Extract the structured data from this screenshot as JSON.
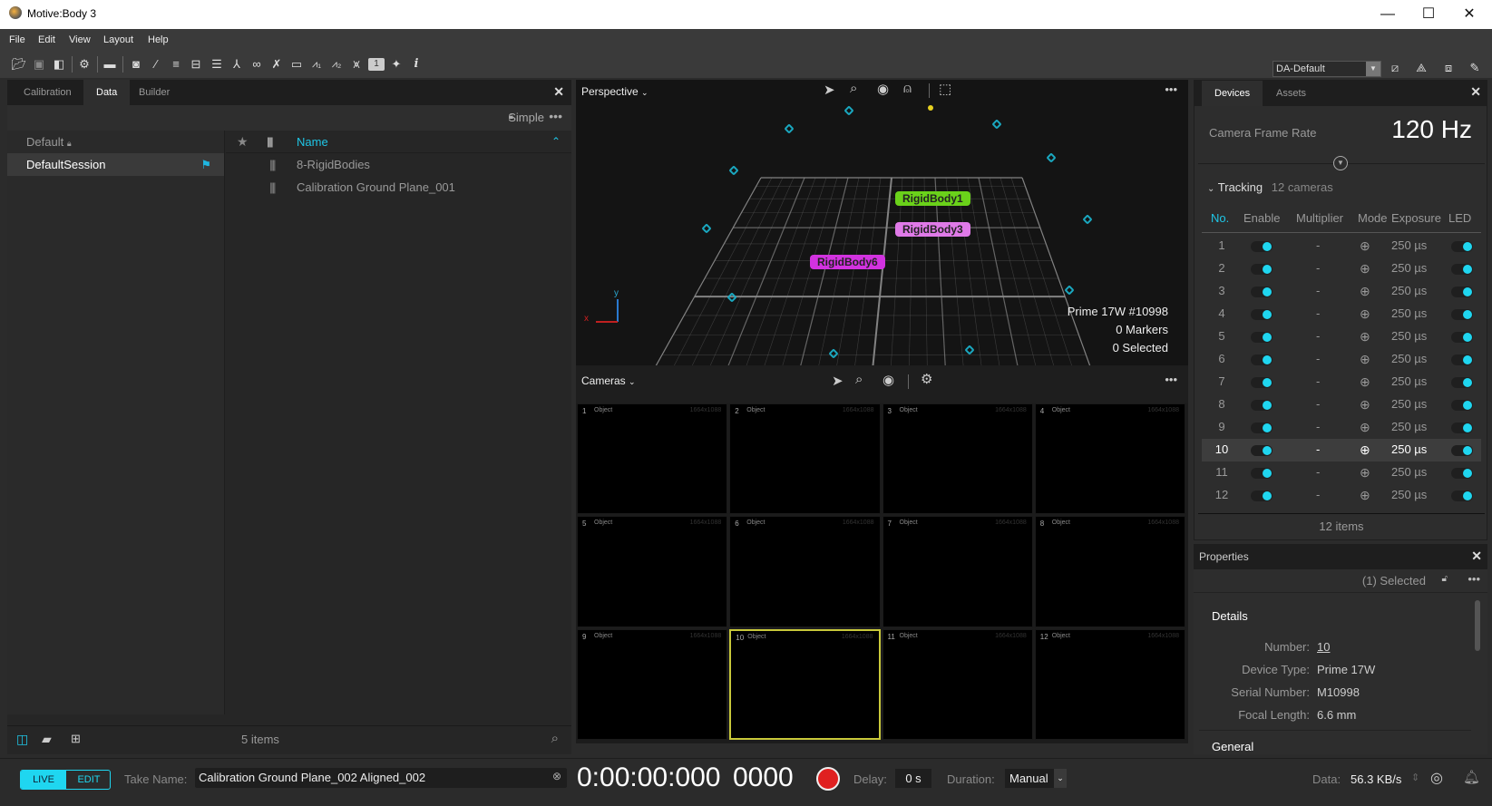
{
  "window": {
    "title": "Motive:Body 3",
    "minimize": "—",
    "maximize": "☐",
    "close": "✕"
  },
  "menu": [
    "File",
    "Edit",
    "View",
    "Layout",
    "Help"
  ],
  "toolbar": {
    "icons": [
      "open-icon",
      "save-icon",
      "save-as-icon",
      "settings-icon",
      "panel-icon",
      "camera-snapshot-icon",
      "wand-icon",
      "database-icon",
      "archive-icon",
      "list-settings-icon",
      "skeleton-icon",
      "link-icon",
      "tools-icon",
      "tag-icon",
      "graph1-icon",
      "graph2-icon",
      "filter-icon",
      "number-one-icon",
      "marker-icon",
      "info-icon"
    ],
    "layout_select": "DA-Default",
    "layout_icons": [
      "layout-calibrate-icon",
      "layout-create-icon",
      "layout-capture-icon",
      "layout-edit-icon"
    ]
  },
  "left_panel": {
    "tabs": [
      "Calibration",
      "Data",
      "Builder"
    ],
    "active_tab": "Data",
    "mode_label": "Simple",
    "sessions_header": "Default",
    "sessions": [
      {
        "name": "DefaultSession",
        "selected": true
      }
    ],
    "takes_header": {
      "name_col": "Name"
    },
    "takes": [
      {
        "name": "8-RigidBodies"
      },
      {
        "name": "Calibration Ground Plane_001"
      }
    ],
    "footer_count": "5 items"
  },
  "perspective": {
    "title": "Perspective",
    "rigid_bodies": [
      {
        "label": "RigidBody1",
        "color": "#6ad21a"
      },
      {
        "label": "RigidBody3",
        "color": "#e07ae8"
      },
      {
        "label": "RigidBody6",
        "color": "#d232e0"
      }
    ],
    "info": {
      "camera": "Prime 17W #10998",
      "markers": "0 Markers",
      "selected": "0 Selected"
    },
    "axis": {
      "x": "x",
      "y": "y"
    }
  },
  "cameras": {
    "title": "Cameras",
    "tiles": [
      {
        "num": "1",
        "mode": "Object",
        "res": "1664x1088"
      },
      {
        "num": "2",
        "mode": "Object",
        "res": "1664x1088"
      },
      {
        "num": "3",
        "mode": "Object",
        "res": "1664x1088"
      },
      {
        "num": "4",
        "mode": "Object",
        "res": "1664x1088"
      },
      {
        "num": "5",
        "mode": "Object",
        "res": "1664x1088"
      },
      {
        "num": "6",
        "mode": "Object",
        "res": "1664x1088"
      },
      {
        "num": "7",
        "mode": "Object",
        "res": "1664x1088"
      },
      {
        "num": "8",
        "mode": "Object",
        "res": "1664x1088"
      },
      {
        "num": "9",
        "mode": "Object",
        "res": "1664x1088"
      },
      {
        "num": "10",
        "mode": "Object",
        "res": "1664x1088",
        "selected": true
      },
      {
        "num": "11",
        "mode": "Object",
        "res": "1664x1088"
      },
      {
        "num": "12",
        "mode": "Object",
        "res": "1664x1088"
      }
    ]
  },
  "devices": {
    "tabs": [
      "Devices",
      "Assets"
    ],
    "frame_rate_label": "Camera Frame Rate",
    "frame_rate": "120 Hz",
    "group": "Tracking",
    "group_count": "12 cameras",
    "columns": [
      "No.",
      "Enable",
      "Multiplier",
      "Mode",
      "Exposure",
      "LED"
    ],
    "rows": [
      {
        "no": "1",
        "mult": "-",
        "exp": "250 µs",
        "enable": true,
        "led": true
      },
      {
        "no": "2",
        "mult": "-",
        "exp": "250 µs",
        "enable": true,
        "led": true
      },
      {
        "no": "3",
        "mult": "-",
        "exp": "250 µs",
        "enable": true,
        "led": true
      },
      {
        "no": "4",
        "mult": "-",
        "exp": "250 µs",
        "enable": true,
        "led": true
      },
      {
        "no": "5",
        "mult": "-",
        "exp": "250 µs",
        "enable": true,
        "led": true
      },
      {
        "no": "6",
        "mult": "-",
        "exp": "250 µs",
        "enable": true,
        "led": true
      },
      {
        "no": "7",
        "mult": "-",
        "exp": "250 µs",
        "enable": true,
        "led": true
      },
      {
        "no": "8",
        "mult": "-",
        "exp": "250 µs",
        "enable": true,
        "led": true
      },
      {
        "no": "9",
        "mult": "-",
        "exp": "250 µs",
        "enable": true,
        "led": true
      },
      {
        "no": "10",
        "mult": "-",
        "exp": "250 µs",
        "enable": true,
        "led": true,
        "selected": true
      },
      {
        "no": "11",
        "mult": "-",
        "exp": "250 µs",
        "enable": true,
        "led": true
      },
      {
        "no": "12",
        "mult": "-",
        "exp": "250 µs",
        "enable": true,
        "led": true
      }
    ],
    "footer": "12 items"
  },
  "properties": {
    "title": "Properties",
    "selected": "(1) Selected",
    "section": "Details",
    "fields": [
      {
        "label": "Number:",
        "value": "10"
      },
      {
        "label": "Device Type:",
        "value": "Prime 17W"
      },
      {
        "label": "Serial Number:",
        "value": "M10998"
      },
      {
        "label": "Focal Length:",
        "value": "6.6 mm"
      }
    ],
    "next_section": "General"
  },
  "bottom": {
    "live": "LIVE",
    "edit": "EDIT",
    "take_name_label": "Take Name:",
    "take_name": "Calibration Ground Plane_002 Aligned_002",
    "timecode": "0:00:00:000",
    "frame": "0000",
    "delay_label": "Delay:",
    "delay": "0 s",
    "duration_label": "Duration:",
    "duration": "Manual",
    "data_label": "Data:",
    "data_rate": "56.3 KB/s"
  },
  "colors": {
    "accent": "#1fd6f0",
    "record": "#e02020",
    "selected_tile": "#c8c83a"
  }
}
